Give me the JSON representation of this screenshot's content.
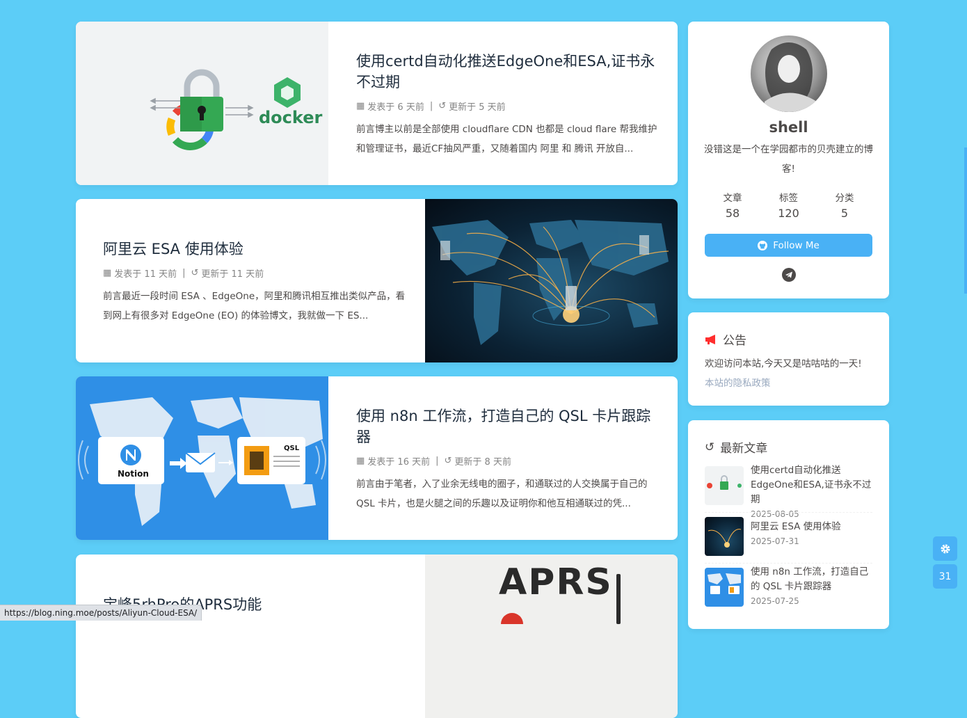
{
  "posts": [
    {
      "title": "使用certd自动化推送EdgeOne和ESA,证书永不过期",
      "published": "发表于 6 天前",
      "updated": "更新于 5 天前",
      "excerpt": "前言博主以前是全部使用 cloudflare CDN 也都是 cloud flare 帮我维护和管理证书，最近CF抽风严重，又随着国内 阿里 和 腾讯 开放自...",
      "cover_text": "docker"
    },
    {
      "title": "阿里云 ESA 使用体验",
      "published": "发表于 11 天前",
      "updated": "更新于 11 天前",
      "excerpt": "前言最近一段时间 ESA 、EdgeOne，阿里和腾讯相互推出类似产品，看到网上有很多对 EdgeOne (EO) 的体验博文，我就做一下 ES..."
    },
    {
      "title": "使用 n8n 工作流，打造自己的 QSL 卡片跟踪器",
      "published": "发表于 16 天前",
      "updated": "更新于 8 天前",
      "excerpt": "前言由于笔者，入了业余无线电的圈子，和通联过的人交换属于自己的 QSL 卡片，也是火腿之间的乐趣以及证明你和他互相通联过的凭...",
      "cover_notion": "Notion",
      "cover_qsl": "QSL"
    },
    {
      "title": "宝峰5rhPro的APRS功能",
      "cover_text": "APRS"
    }
  ],
  "author": {
    "name": "shell",
    "description": "没错这是一个在学园都市的贝壳建立的博客!",
    "stats": [
      {
        "label": "文章",
        "value": "58"
      },
      {
        "label": "标签",
        "value": "120"
      },
      {
        "label": "分类",
        "value": "5"
      }
    ],
    "follow_label": "Follow Me"
  },
  "announcement": {
    "title": "公告",
    "text": "欢迎访问本站,今天又是咕咕咕的一天!",
    "link": "本站的隐私政策"
  },
  "recent": {
    "title": "最新文章",
    "items": [
      {
        "title": "使用certd自动化推送EdgeOne和ESA,证书永不过期",
        "date": "2025-08-05"
      },
      {
        "title": "阿里云 ESA 使用体验",
        "date": "2025-07-31"
      },
      {
        "title": "使用 n8n 工作流，打造自己的 QSL 卡片跟踪器",
        "date": "2025-07-25"
      }
    ]
  },
  "float_buttons": {
    "counter": "31"
  },
  "status_url": "https://blog.ning.moe/posts/Aliyun-Cloud-ESA/",
  "colors": {
    "background": "#5ccdf7",
    "accent": "#49b1f5",
    "title": "#1f2d3d"
  }
}
